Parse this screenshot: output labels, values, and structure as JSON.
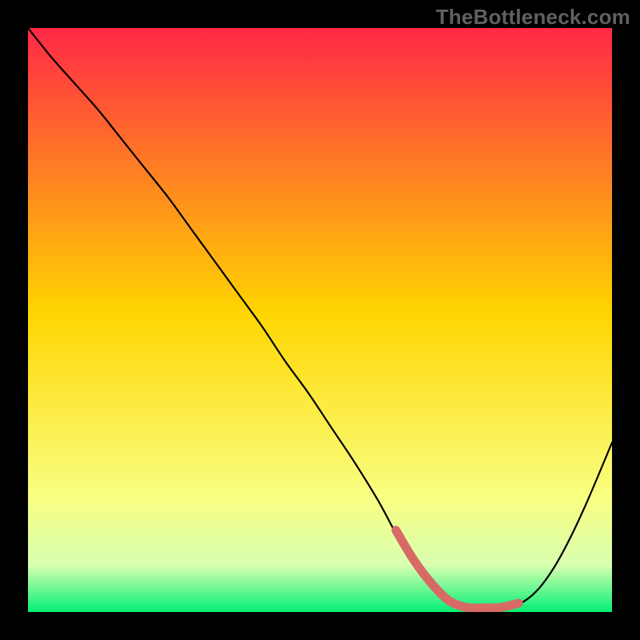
{
  "watermark": "TheBottleneck.com",
  "colors": {
    "background": "#000000",
    "gradient_top": "#ff2846",
    "gradient_mid": "#ffd600",
    "gradient_low1": "#f9ff80",
    "gradient_low2": "#d8ffb0",
    "gradient_bottom": "#00ef74",
    "curve": "#000000",
    "highlight": "#d86a66"
  },
  "chart_data": {
    "type": "line",
    "title": "",
    "xlabel": "",
    "ylabel": "",
    "xlim": [
      0,
      100
    ],
    "ylim": [
      0,
      100
    ],
    "series": [
      {
        "name": "curve",
        "x": [
          0,
          4,
          8,
          12,
          16,
          20,
          24,
          28,
          32,
          36,
          40,
          44,
          48,
          52,
          56,
          60,
          63,
          66,
          69,
          72,
          75,
          78,
          81,
          84,
          87,
          90,
          93,
          96,
          100
        ],
        "values": [
          100,
          95,
          90.5,
          86,
          81,
          76,
          71,
          65.5,
          60,
          54.5,
          49,
          43,
          37.5,
          31.5,
          25.5,
          19,
          13.5,
          9,
          5,
          2,
          0.6,
          0.4,
          0.5,
          1.3,
          3.5,
          7.5,
          13,
          19.5,
          29
        ]
      },
      {
        "name": "highlight",
        "x": [
          63,
          66,
          69,
          72,
          75,
          78,
          81,
          84
        ],
        "values": [
          14,
          9,
          5,
          2,
          0.8,
          0.7,
          0.8,
          1.5
        ]
      }
    ],
    "gradient_stops": [
      {
        "offset": 0.0,
        "key": "gradient_top"
      },
      {
        "offset": 0.49,
        "key": "gradient_mid"
      },
      {
        "offset": 0.8,
        "key": "gradient_low1"
      },
      {
        "offset": 0.92,
        "key": "gradient_low2"
      },
      {
        "offset": 1.0,
        "key": "gradient_bottom"
      }
    ]
  }
}
